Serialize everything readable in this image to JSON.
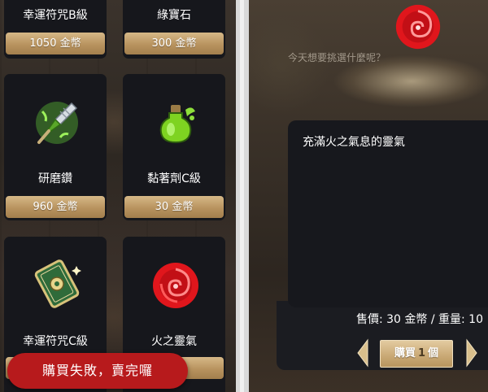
{
  "shop": {
    "items": [
      {
        "name": "幸運符咒B級",
        "price": "1050 金幣",
        "icon": "scroll-icon"
      },
      {
        "name": "綠寶石",
        "price": "300 金幣",
        "icon": "emerald-icon"
      },
      {
        "name": "研磨鑽",
        "price": "960 金幣",
        "icon": "drill-icon"
      },
      {
        "name": "黏著劑C級",
        "price": "30 金幣",
        "icon": "potion-icon"
      },
      {
        "name": "幸運符咒C級",
        "price": "",
        "icon": "charm-card-icon"
      },
      {
        "name": "火之靈氣",
        "price": "",
        "icon": "fire-aura-icon"
      }
    ]
  },
  "detail": {
    "greeting": "今天想要挑選什麼呢？",
    "description": "充滿火之氣息的靈氣",
    "price_line": "售價: 30 金幣 / 重量: 10",
    "buy_prefix": "購買",
    "quantity": "1",
    "buy_suffix": "個"
  },
  "toast": {
    "message": "購買失敗，賣完囉"
  },
  "colors": {
    "card_bg": "#16171c",
    "price_gold": "#b8935f",
    "toast_red": "#b71a1c"
  }
}
